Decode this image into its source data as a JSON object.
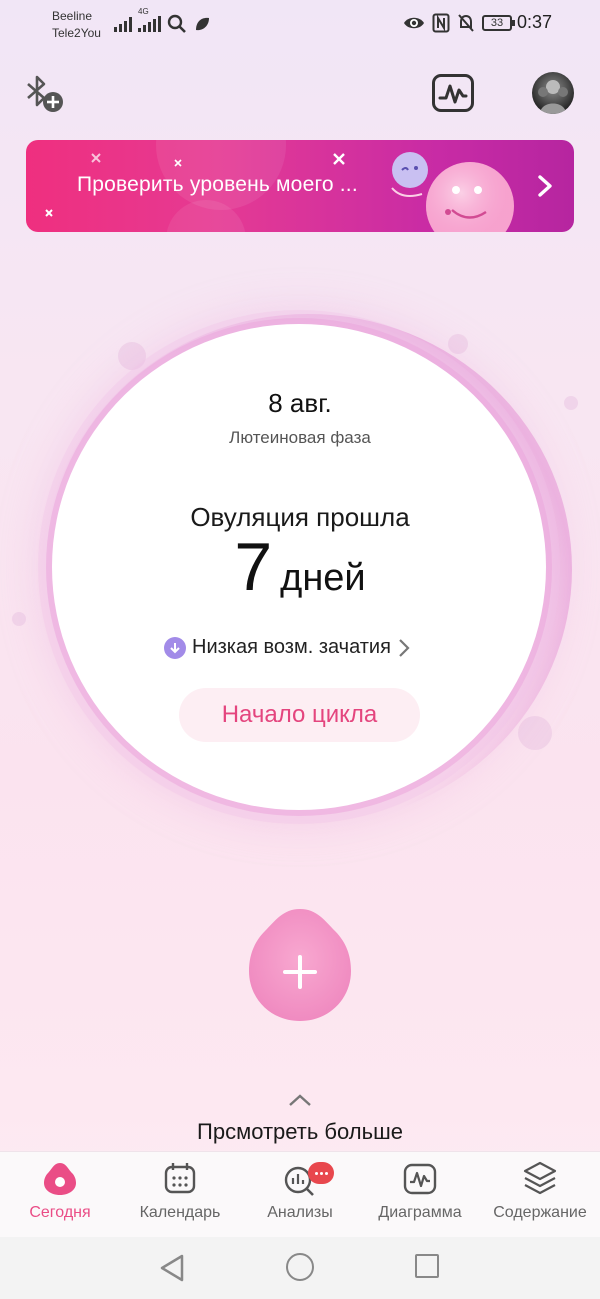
{
  "status_bar": {
    "carrier_1": "Beeline",
    "carrier_2": "Tele2You",
    "network": "4G",
    "battery": "33",
    "time": "0:37",
    "icons": [
      "signal-icon",
      "signal-4g-icon",
      "search-icon",
      "leaf-icon",
      "eye-icon",
      "nfc-icon",
      "mute-icon",
      "battery-icon"
    ]
  },
  "header": {
    "bluetooth_add_icon": "bluetooth-add-icon",
    "chart_icon": "chart-icon",
    "avatar_icon": "avatar"
  },
  "banner": {
    "text": "Проверить уровень моего ...",
    "gradient_start": "#ef2f7f",
    "gradient_end": "#b625a0"
  },
  "cycle": {
    "date": "8 авг.",
    "phase": "Лютеиновая фаза",
    "ovulation_title": "Овуляция прошла",
    "days_number": "7",
    "days_unit": "дней",
    "chance_label": "Низкая возм. зачатия",
    "cycle_start_button": "Начало цикла",
    "accent_color": "#e4457e",
    "chance_dot_color": "#a28be8"
  },
  "actions": {
    "add_icon": "plus-icon",
    "see_more": "Прсмотреть больше"
  },
  "tabs": [
    {
      "label": "Сегодня",
      "icon": "today-drop-icon",
      "active": true
    },
    {
      "label": "Календарь",
      "icon": "calendar-icon",
      "active": false
    },
    {
      "label": "Анализы",
      "icon": "analysis-icon",
      "active": false
    },
    {
      "label": "Диаграмма",
      "icon": "chart-icon",
      "active": false
    },
    {
      "label": "Содержание",
      "icon": "layers-icon",
      "active": false
    }
  ],
  "system_nav": [
    "back-icon",
    "home-icon",
    "recents-icon"
  ]
}
